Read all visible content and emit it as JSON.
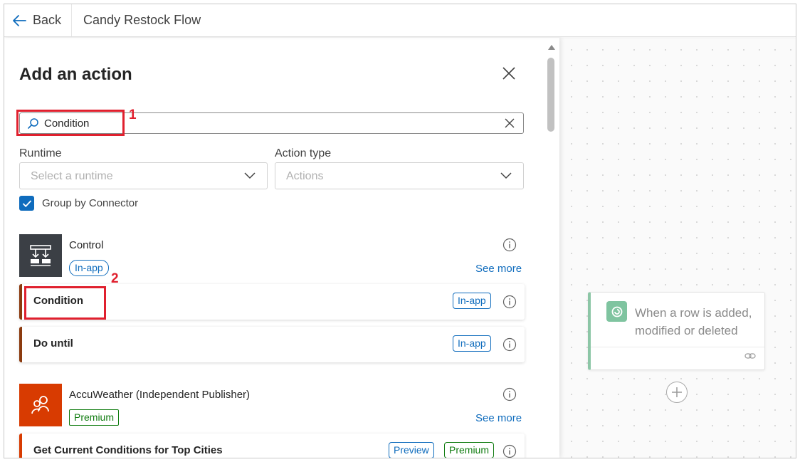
{
  "header": {
    "back_label": "Back",
    "flow_title": "Candy Restock Flow"
  },
  "panel": {
    "title": "Add an action",
    "search": {
      "value": "Condition",
      "placeholder": ""
    },
    "runtime": {
      "label": "Runtime",
      "placeholder": "Select a runtime"
    },
    "action_type": {
      "label": "Action type",
      "placeholder": "Actions"
    },
    "group_by_connector": {
      "label": "Group by Connector",
      "checked": true
    },
    "connectors": [
      {
        "name": "Control",
        "tag": "In-app",
        "see_more": "See more",
        "icon": "control-icon",
        "color": "#3b3f45",
        "actions": [
          {
            "name": "Condition",
            "tags": [
              "In-app"
            ]
          },
          {
            "name": "Do until",
            "tags": [
              "In-app"
            ]
          }
        ]
      },
      {
        "name": "AccuWeather (Independent Publisher)",
        "tag": "Premium",
        "see_more": "See more",
        "icon": "accuweather-icon",
        "color": "#d83b01",
        "actions": [
          {
            "name": "Get Current Conditions for Top Cities",
            "tags": [
              "Preview",
              "Premium"
            ]
          }
        ]
      }
    ]
  },
  "annotations": {
    "step1": "1",
    "step2": "2"
  },
  "canvas": {
    "trigger": {
      "title": "When a row is added, modified or deleted",
      "icon": "dataverse-icon",
      "color": "#7fc4a0"
    }
  },
  "colors": {
    "accent": "#0f6cbd",
    "premium": "#107c10",
    "annotation": "#e0202e"
  }
}
